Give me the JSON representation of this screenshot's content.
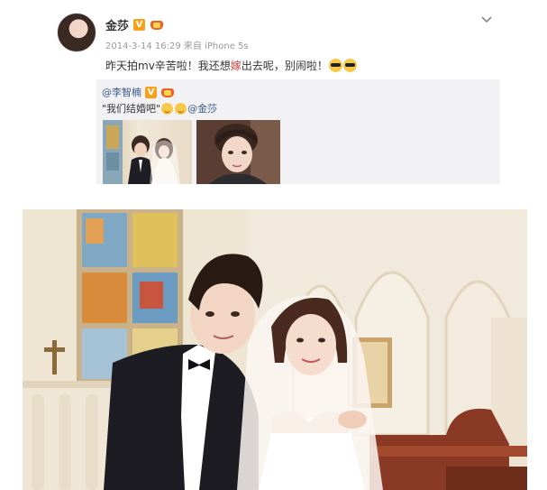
{
  "post": {
    "author": "金莎",
    "verified_badge": "V",
    "meta": "2014-3-14 16:29 来自 iPhone 5s",
    "text_before": "昨天拍mv辛苦啦！我还想",
    "text_highlight": "嫁",
    "text_after": "出去呢，别闹啦！",
    "icons": {
      "avatar": "avatar",
      "menu": "chevron-down-icon",
      "emoji": "sunglasses-emoji-icon"
    }
  },
  "repost": {
    "author": "@李智楠",
    "verified_badge": "V",
    "text": "\"我们结婚吧\"",
    "mention": "@金莎",
    "thumbnails": [
      "wedding-thumbnail",
      "portrait-thumbnail"
    ]
  },
  "photo": {
    "subject": "wedding-photo"
  },
  "colors": {
    "link": "#3a5a8c",
    "highlight": "#d23b3b",
    "badge": "#f7a21a",
    "repost_bg": "#f2f2f5"
  }
}
